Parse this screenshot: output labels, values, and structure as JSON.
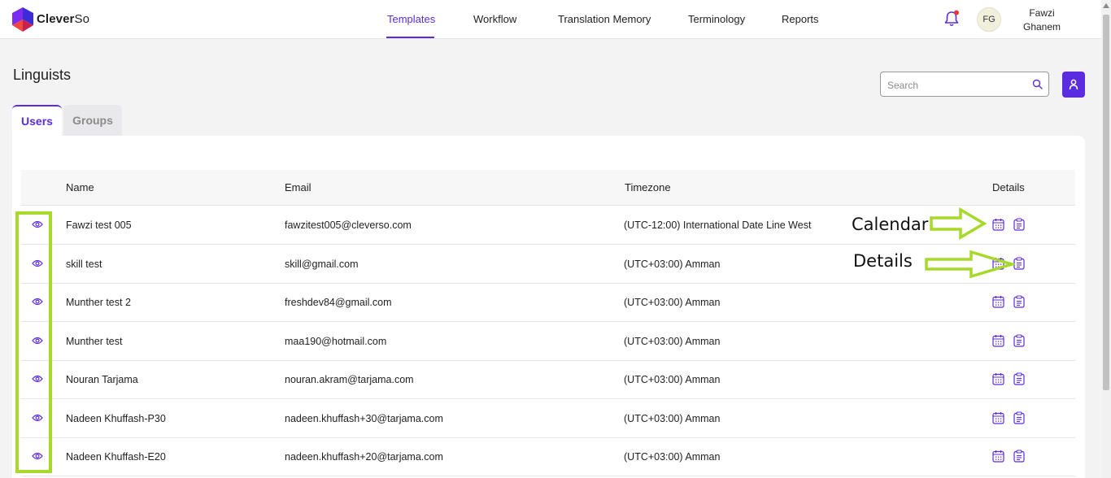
{
  "header": {
    "brand_bold": "Clever",
    "brand_light": "So",
    "nav": [
      {
        "label": "Templates",
        "active": true
      },
      {
        "label": "Workflow",
        "active": false
      },
      {
        "label": "Translation Memory",
        "active": false
      },
      {
        "label": "Terminology",
        "active": false
      },
      {
        "label": "Reports",
        "active": false
      }
    ],
    "user": {
      "initials": "FG",
      "first_name": "Fawzi",
      "last_name": "Ghanem"
    },
    "icons": {
      "notifications": "bell-icon",
      "notification_dot_color": "#e53935"
    }
  },
  "page": {
    "title": "Linguists",
    "search_placeholder": "Search",
    "tabs": [
      {
        "label": "Users",
        "active": true
      },
      {
        "label": "Groups",
        "active": false
      }
    ]
  },
  "table": {
    "columns": [
      "Name",
      "Email",
      "Timezone",
      "Details"
    ],
    "rows": [
      {
        "name": "Fawzi test 005",
        "email": "fawzitest005@cleverso.com",
        "timezone": "(UTC-12:00) International Date Line West"
      },
      {
        "name": "skill test",
        "email": "skill@gmail.com",
        "timezone": "(UTC+03:00) Amman"
      },
      {
        "name": "Munther test 2",
        "email": "freshdev84@gmail.com",
        "timezone": "(UTC+03:00) Amman"
      },
      {
        "name": "Munther test",
        "email": "maa190@hotmail.com",
        "timezone": "(UTC+03:00) Amman"
      },
      {
        "name": "Nouran Tarjama",
        "email": "nouran.akram@tarjama.com",
        "timezone": "(UTC+03:00) Amman"
      },
      {
        "name": "Nadeen Khuffash-P30",
        "email": "nadeen.khuffash+30@tarjama.com",
        "timezone": "(UTC+03:00) Amman"
      },
      {
        "name": "Nadeen Khuffash-E20",
        "email": "nadeen.khuffash+20@tarjama.com",
        "timezone": "(UTC+03:00) Amman"
      }
    ]
  },
  "annotations": {
    "calendar_label": "Calendar",
    "details_label": "Details",
    "highlight_color": "#a6d92a"
  },
  "colors": {
    "accent": "#5b2be0"
  }
}
